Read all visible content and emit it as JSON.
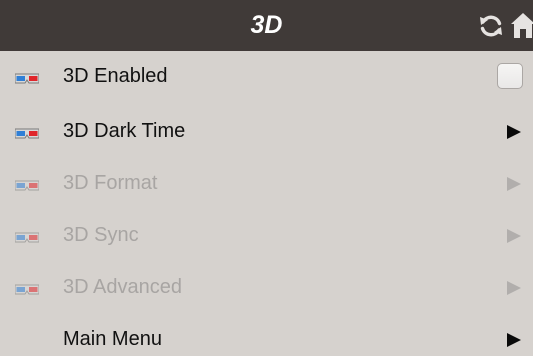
{
  "header": {
    "title": "3D",
    "refresh_icon": "refresh-icon",
    "home_icon": "home-icon"
  },
  "menu": {
    "items": [
      {
        "label": "3D Enabled",
        "icon": "3d-glasses-icon",
        "control": "checkbox",
        "checked": false,
        "enabled": true
      },
      {
        "label": "3D Dark Time",
        "icon": "3d-glasses-icon",
        "control": "submenu-arrow",
        "enabled": true
      },
      {
        "label": "3D Format",
        "icon": "3d-glasses-icon",
        "control": "submenu-arrow",
        "enabled": false
      },
      {
        "label": "3D Sync",
        "icon": "3d-glasses-icon",
        "control": "submenu-arrow",
        "enabled": false
      },
      {
        "label": "3D Advanced",
        "icon": "3d-glasses-icon",
        "control": "submenu-arrow",
        "enabled": false
      },
      {
        "label": "Main Menu",
        "icon": "",
        "control": "submenu-arrow",
        "enabled": true
      }
    ]
  },
  "colors": {
    "titlebar": "#403a38",
    "panel": "#d6d2ce",
    "disabled_text": "#a8a5a3",
    "glasses_red": "#e0262b",
    "glasses_blue": "#2f7fd6"
  }
}
